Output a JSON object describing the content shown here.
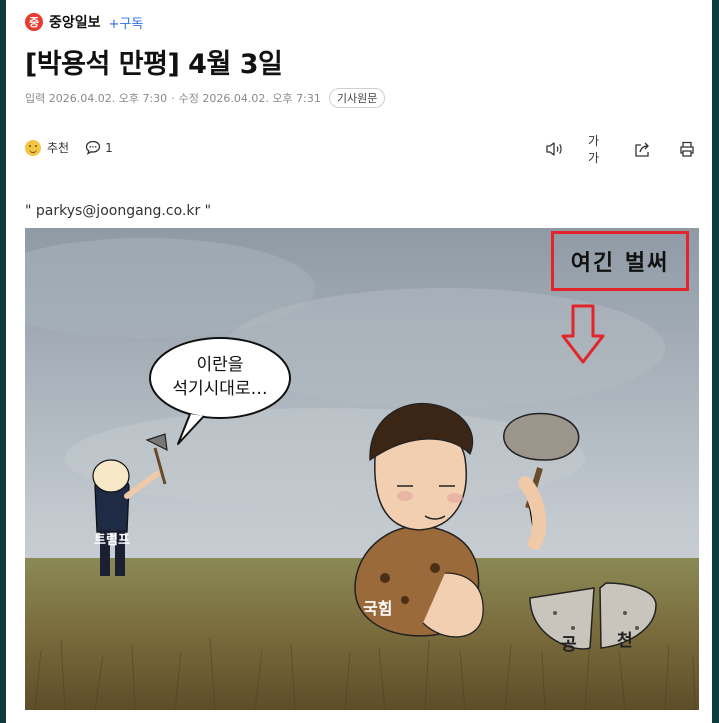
{
  "press": {
    "logo_text": "중",
    "name": "중앙일보",
    "subscribe_label": "+구독"
  },
  "article": {
    "title": "[박용석 만평] 4월 3일",
    "input_label": "입력",
    "input_time": "2026.04.02. 오후 7:30",
    "modified_label": "수정",
    "modified_time": "2026.04.02. 오후 7:31",
    "original_button": "기사원문",
    "email_line": "\" parkys@joongang.co.kr \""
  },
  "reactions": {
    "like_label": "추천",
    "comment_count": "1"
  },
  "tools": {
    "font_size_label": "가가"
  },
  "cartoon": {
    "speech_line1": "이란을",
    "speech_line2": "석기시대로…",
    "trump_label": "트럼프",
    "ppp_label": "국힘",
    "pot_left": "공",
    "pot_right": "천"
  },
  "annotation": {
    "text": "여긴 벌써",
    "box_color": "#e3242b"
  },
  "colors": {
    "subscribe": "#2f6fe8",
    "logo": "#e73c2e",
    "background": "#0f3b3f"
  }
}
